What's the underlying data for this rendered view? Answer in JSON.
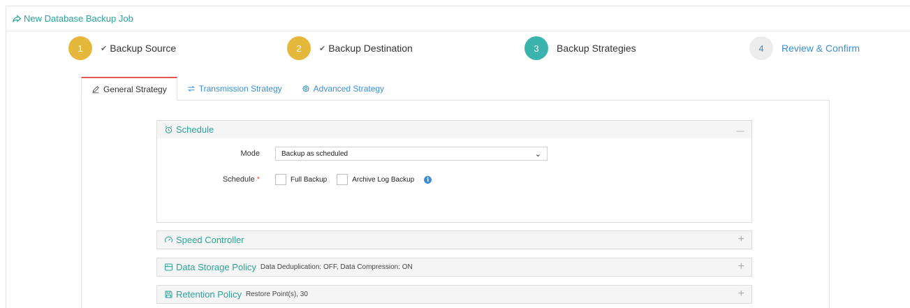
{
  "header": {
    "title": "New Database Backup Job"
  },
  "steps": [
    {
      "number": "1",
      "label": "Backup Source",
      "completed": true,
      "color": "#e5b73a"
    },
    {
      "number": "2",
      "label": "Backup Destination",
      "completed": true,
      "color": "#e5b73a"
    },
    {
      "number": "3",
      "label": "Backup Strategies",
      "completed": false,
      "color": "#3bb3ad"
    },
    {
      "number": "4",
      "label": "Review & Confirm",
      "completed": false,
      "color": "#ececec"
    }
  ],
  "tabs": [
    {
      "label": "General Strategy",
      "icon": "pencil-icon",
      "active": true
    },
    {
      "label": "Transmission Strategy",
      "icon": "arrows-exchange-icon",
      "active": false
    },
    {
      "label": "Advanced Strategy",
      "icon": "gear-icon",
      "active": false
    }
  ],
  "schedule": {
    "title": "Schedule",
    "toggle": "—",
    "mode_label": "Mode",
    "mode_value": "Backup as scheduled",
    "schedule_label": "Schedule",
    "required_mark": "*",
    "full_backup_label": "Full Backup",
    "archive_log_label": "Archive Log Backup"
  },
  "speed_controller": {
    "title": "Speed Controller",
    "toggle": "+"
  },
  "data_storage": {
    "title": "Data Storage Policy",
    "summary": "Data Deduplication: OFF, Data Compression: ON",
    "toggle": "+"
  },
  "retention": {
    "title": "Retention Policy",
    "summary": "Restore Point(s), 30",
    "toggle": "+"
  },
  "colors": {
    "accent": "#2aa39a",
    "link": "#3a8fd0",
    "active_tab_border": "#e05a4e"
  }
}
